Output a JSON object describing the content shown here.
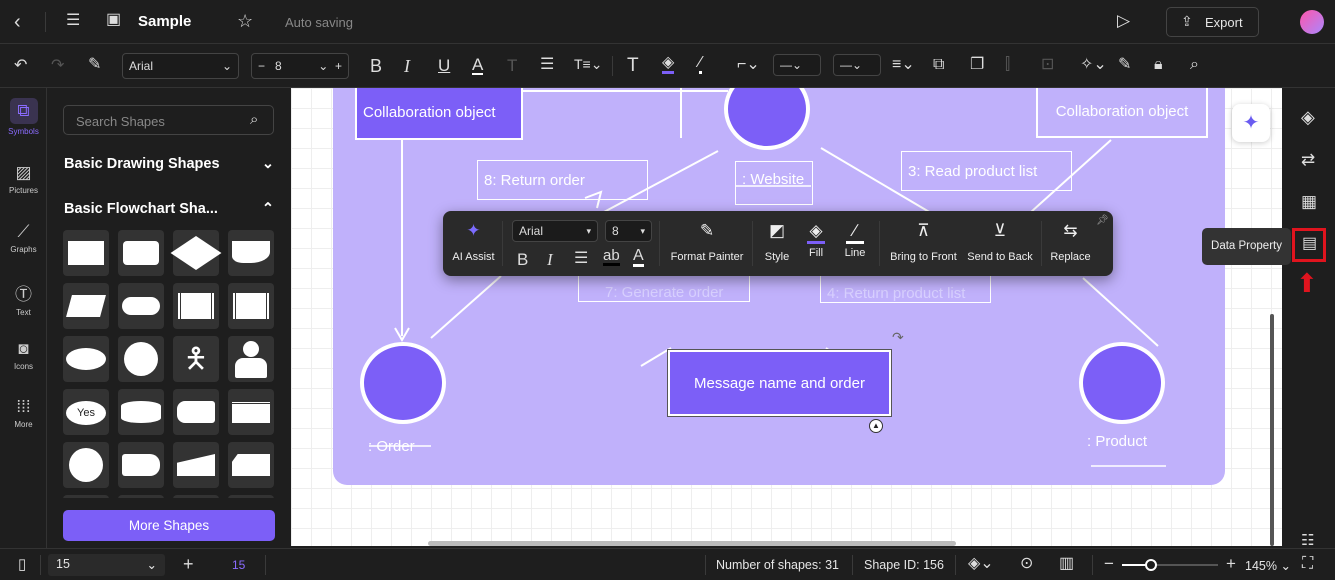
{
  "topbar": {
    "title": "Sample",
    "status": "Auto saving",
    "export_label": "Export"
  },
  "toolbar": {
    "font": "Arial",
    "font_size": "8"
  },
  "rail": [
    {
      "label": "Symbols",
      "icon": "symbols-icon"
    },
    {
      "label": "Pictures",
      "icon": "picture-icon"
    },
    {
      "label": "Graphs",
      "icon": "graph-icon"
    },
    {
      "label": "Text",
      "icon": "text-icon"
    },
    {
      "label": "Icons",
      "icon": "icons-icon"
    },
    {
      "label": "More",
      "icon": "grid-dots-icon"
    }
  ],
  "panel": {
    "search_placeholder": "Search Shapes",
    "sections": [
      "Basic Drawing Shapes",
      "Basic Flowchart Sha..."
    ],
    "yes_shape": "Yes",
    "more_shapes": "More Shapes"
  },
  "diagram": {
    "collab_left": "Collaboration object",
    "collab_right": "Collaboration object",
    "website": ": Website",
    "return_order": "8: Return order",
    "read_list": "3: Read product list",
    "generate_order": "7: Generate order",
    "return_list": "4: Return product list",
    "message": "Message name and order",
    "order": ": Order",
    "product": ": Product"
  },
  "floating_toolbar": {
    "ai": "AI Assist",
    "font": "Arial",
    "size": "8",
    "format_painter": "Format Painter",
    "style": "Style",
    "fill": "Fill",
    "line": "Line",
    "front": "Bring to Front",
    "back": "Send to Back",
    "replace": "Replace"
  },
  "tooltip": "Data Property",
  "status": {
    "page": "15",
    "page_tab": "15",
    "shapes": "Number of shapes: 31",
    "shape_id": "Shape ID: 156",
    "zoom": "145%",
    "zoom_fraction": 0.3
  },
  "colors": {
    "accent": "#7c5ff7",
    "board": "#c0b1fb",
    "highlight": "#e0141e"
  }
}
